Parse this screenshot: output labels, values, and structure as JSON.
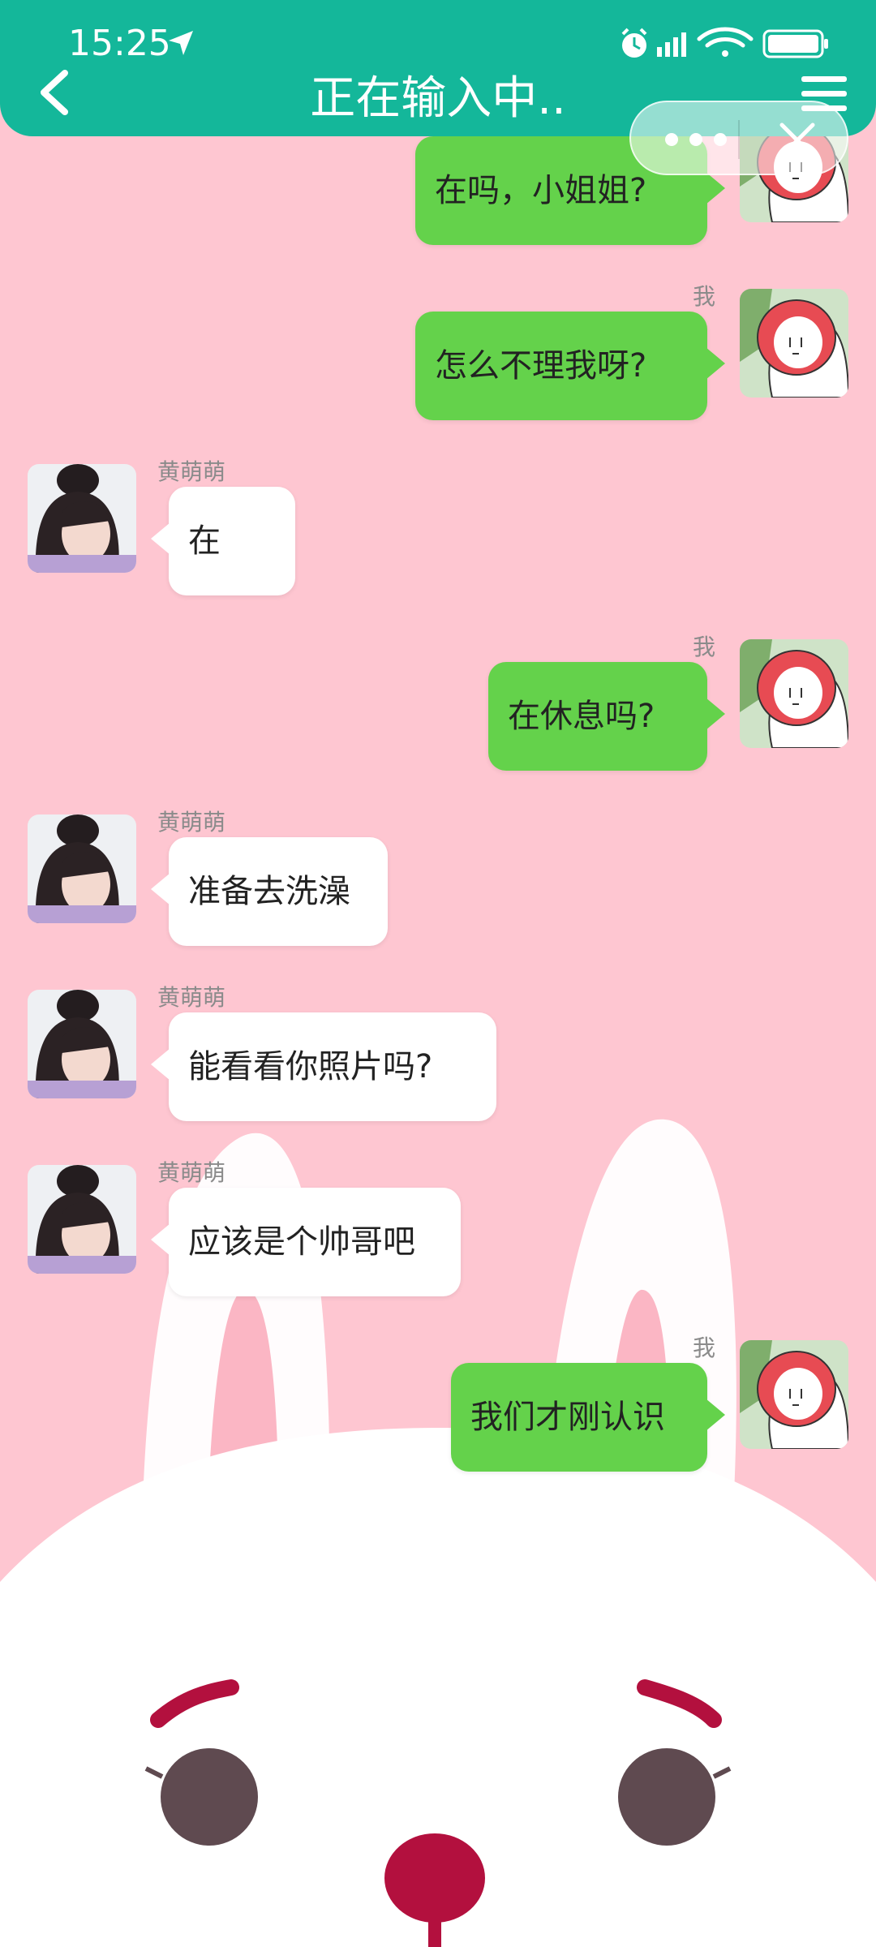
{
  "status_bar": {
    "time": "15:25"
  },
  "header": {
    "title": "正在输入中.."
  },
  "colors": {
    "header_bg": "#14b79a",
    "background_pink": "#fec6d1",
    "bubble_me": "#64d24b",
    "bubble_her": "#ffffff"
  },
  "icons": {
    "back": "back-arrow-icon",
    "menu": "menu-icon",
    "capsule_more": "more-dots-icon",
    "capsule_close": "close-icon"
  },
  "messages": [
    {
      "sender": "me",
      "name": "",
      "text": "在吗，小姐姐?"
    },
    {
      "sender": "me",
      "name": "我",
      "text": "怎么不理我呀?"
    },
    {
      "sender": "her",
      "name": "黄萌萌",
      "text": "在"
    },
    {
      "sender": "me",
      "name": "我",
      "text": "在休息吗?"
    },
    {
      "sender": "her",
      "name": "黄萌萌",
      "text": "准备去洗澡"
    },
    {
      "sender": "her",
      "name": "黄萌萌",
      "text": "能看看你照片吗?"
    },
    {
      "sender": "her",
      "name": "黄萌萌",
      "text": "应该是个帅哥吧"
    },
    {
      "sender": "me",
      "name": "我",
      "text": "我们才刚认识"
    }
  ]
}
